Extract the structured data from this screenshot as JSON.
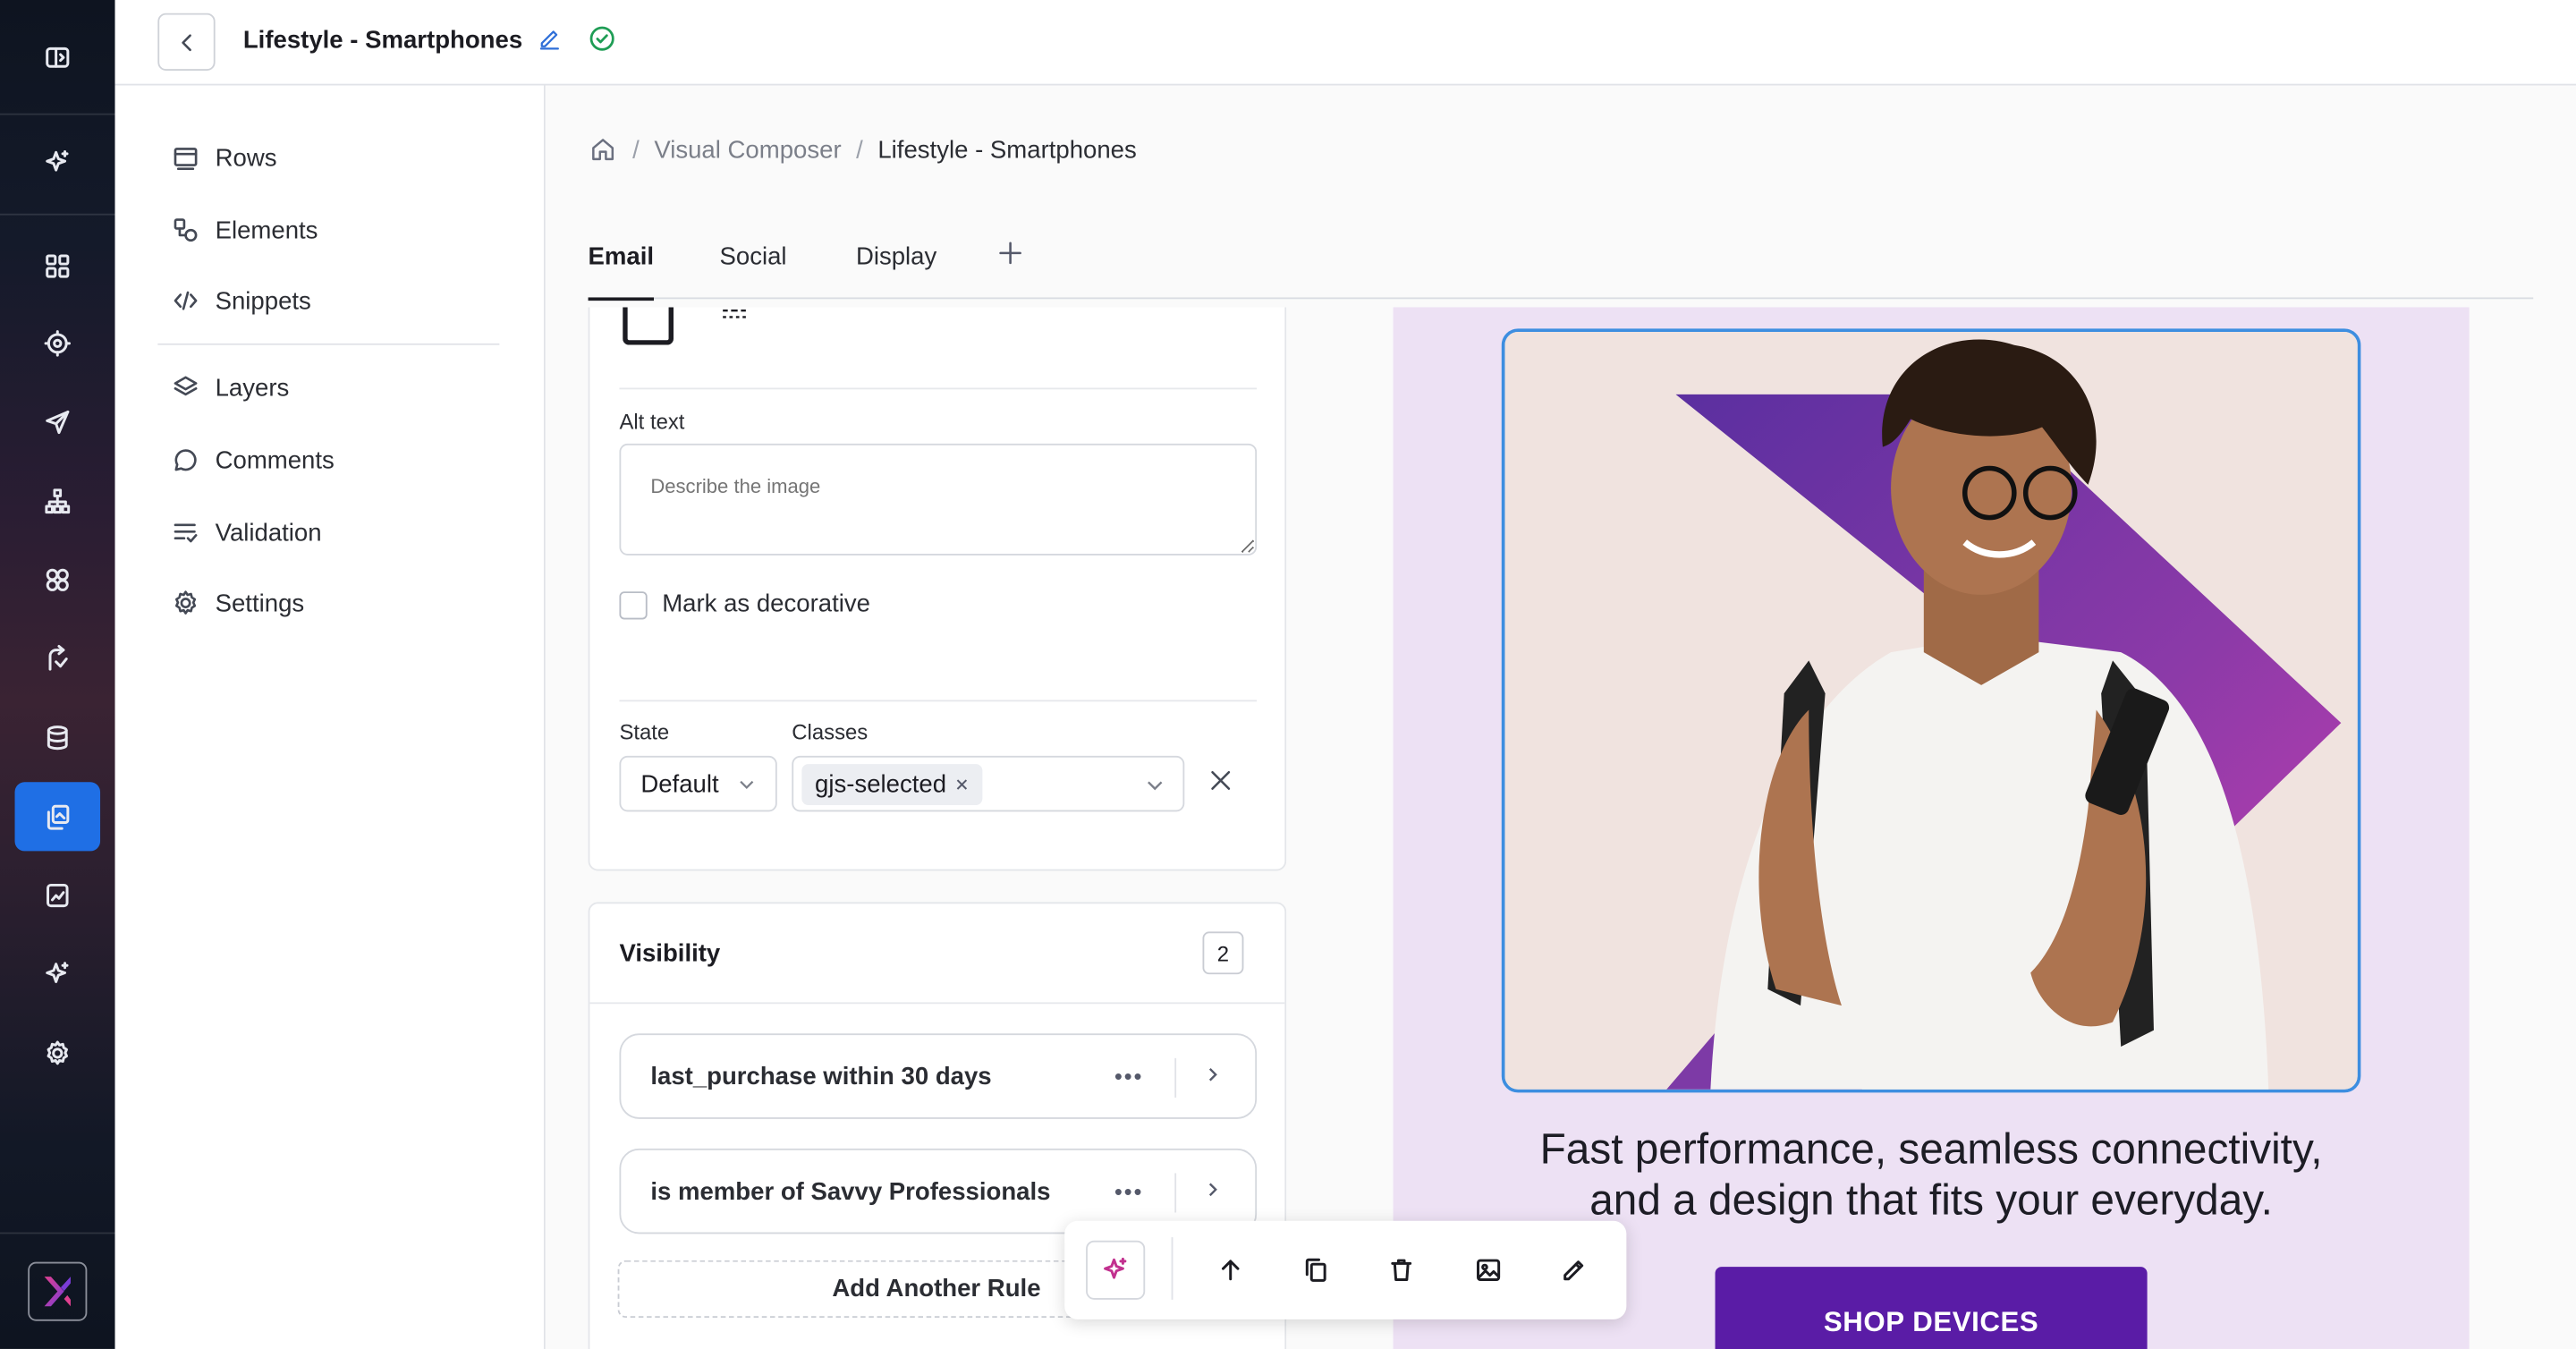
{
  "header": {
    "title": "Lifestyle - Smartphones"
  },
  "sidebar": {
    "items": [
      {
        "label": "Rows"
      },
      {
        "label": "Elements"
      },
      {
        "label": "Snippets"
      },
      {
        "label": "Layers"
      },
      {
        "label": "Comments"
      },
      {
        "label": "Validation"
      },
      {
        "label": "Settings"
      }
    ]
  },
  "breadcrumb": {
    "items": [
      "Visual Composer",
      "Lifestyle - Smartphones"
    ]
  },
  "tabs": [
    {
      "label": "Email"
    },
    {
      "label": "Social"
    },
    {
      "label": "Display"
    }
  ],
  "properties": {
    "alt_text_label": "Alt text",
    "alt_text_placeholder": "Describe the image",
    "alt_text_value": "",
    "decorative_label": "Mark as decorative",
    "state_label": "State",
    "state_value": "Default",
    "classes_label": "Classes",
    "class_chip": "gjs-selected"
  },
  "visibility": {
    "title": "Visibility",
    "count": "2",
    "rules": [
      {
        "label": "last_purchase within 30 days"
      },
      {
        "label": "is member of Savvy Professionals"
      }
    ],
    "add_rule_label": "Add Another Rule"
  },
  "preview": {
    "headline_line1": "Fast performance, seamless connectivity,",
    "headline_line2": "and a design that fits your everyday.",
    "cta_label": "SHOP DEVICES"
  },
  "colors": {
    "accent": "#1f6fe5",
    "cta": "#5a1ca6",
    "preview_bg": "#ede1f4",
    "selection": "#3d8ee0"
  }
}
